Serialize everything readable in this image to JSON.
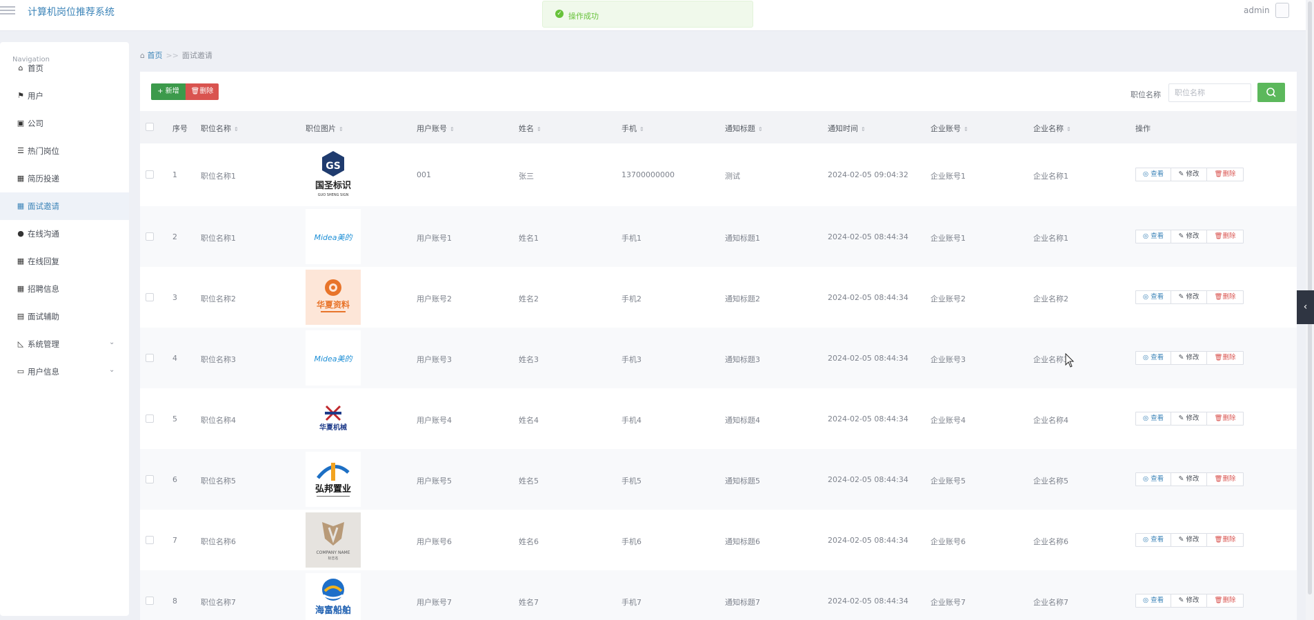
{
  "app": {
    "title": "计算机岗位推荐系统",
    "user": "admin"
  },
  "toast": {
    "message": "操作成功"
  },
  "sidebar": {
    "caption": "Navigation",
    "items": [
      {
        "label": "首页",
        "icon": "home-icon"
      },
      {
        "label": "用户",
        "icon": "flag-icon"
      },
      {
        "label": "公司",
        "icon": "briefcase-icon"
      },
      {
        "label": "热门岗位",
        "icon": "list-icon"
      },
      {
        "label": "简历投递",
        "icon": "grid-icon"
      },
      {
        "label": "面试邀请",
        "icon": "grid-icon",
        "active": true
      },
      {
        "label": "在线沟通",
        "icon": "map-pin-icon"
      },
      {
        "label": "在线回复",
        "icon": "grid-icon"
      },
      {
        "label": "招聘信息",
        "icon": "grid-icon"
      },
      {
        "label": "面试辅助",
        "icon": "comment-icon"
      },
      {
        "label": "系统管理",
        "icon": "chart-icon",
        "expandable": true
      },
      {
        "label": "用户信息",
        "icon": "card-icon",
        "expandable": true
      }
    ]
  },
  "breadcrumb": {
    "home": "首页",
    "separator": ">>",
    "current": "面试邀请"
  },
  "toolbar": {
    "add_label": "新增",
    "delete_label": "删除"
  },
  "search": {
    "label": "职位名称",
    "placeholder": "职位名称"
  },
  "table": {
    "columns": [
      "序号",
      "职位名称",
      "职位图片",
      "用户账号",
      "姓名",
      "手机",
      "通知标题",
      "通知时间",
      "企业账号",
      "企业名称",
      "操作"
    ],
    "actions": {
      "view": "查看",
      "edit": "修改",
      "delete": "删除"
    },
    "rows": [
      {
        "index": "1",
        "job_name": "职位名称1",
        "logo": "guosheng",
        "logo_text": "国圣标识",
        "logo_sub": "GUO SHENG SIGN",
        "account": "001",
        "name": "张三",
        "phone": "13700000000",
        "title": "测试",
        "time": "2024-02-05 09:04:32",
        "company_account": "企业账号1",
        "company_name": "企业名称1"
      },
      {
        "index": "2",
        "job_name": "职位名称1",
        "logo": "midea",
        "logo_text": "Midea美的",
        "logo_sub": "",
        "account": "用户账号1",
        "name": "姓名1",
        "phone": "手机1",
        "title": "通知标题1",
        "time": "2024-02-05 08:44:34",
        "company_account": "企业账号1",
        "company_name": "企业名称1"
      },
      {
        "index": "3",
        "job_name": "职位名称2",
        "logo": "huaxia",
        "logo_text": "华夏资料",
        "logo_sub": "",
        "account": "用户账号2",
        "name": "姓名2",
        "phone": "手机2",
        "title": "通知标题2",
        "time": "2024-02-05 08:44:34",
        "company_account": "企业账号2",
        "company_name": "企业名称2"
      },
      {
        "index": "4",
        "job_name": "职位名称3",
        "logo": "midea",
        "logo_text": "Midea美的",
        "logo_sub": "",
        "account": "用户账号3",
        "name": "姓名3",
        "phone": "手机3",
        "title": "通知标题3",
        "time": "2024-02-05 08:44:34",
        "company_account": "企业账号3",
        "company_name": "企业名称3"
      },
      {
        "index": "5",
        "job_name": "职位名称4",
        "logo": "huaxia-machine",
        "logo_text": "华夏机械",
        "logo_sub": "",
        "account": "用户账号4",
        "name": "姓名4",
        "phone": "手机4",
        "title": "通知标题4",
        "time": "2024-02-05 08:44:34",
        "company_account": "企业账号4",
        "company_name": "企业名称4"
      },
      {
        "index": "6",
        "job_name": "职位名称5",
        "logo": "hongbang",
        "logo_text": "弘邦置业",
        "logo_sub": "",
        "account": "用户账号5",
        "name": "姓名5",
        "phone": "手机5",
        "title": "通知标题5",
        "time": "2024-02-05 08:44:34",
        "company_account": "企业账号5",
        "company_name": "企业名称5"
      },
      {
        "index": "7",
        "job_name": "职位名称6",
        "logo": "company-name",
        "logo_text": "COMPANY NAME",
        "logo_sub": "标志名",
        "account": "用户账号6",
        "name": "姓名6",
        "phone": "手机6",
        "title": "通知标题6",
        "time": "2024-02-05 08:44:34",
        "company_account": "企业账号6",
        "company_name": "企业名称6"
      },
      {
        "index": "8",
        "job_name": "职位名称7",
        "logo": "haiyu",
        "logo_text": "海富船舶",
        "logo_sub": "",
        "account": "用户账号7",
        "name": "姓名7",
        "phone": "手机7",
        "title": "通知标题7",
        "time": "2024-02-05 08:44:34",
        "company_account": "企业账号7",
        "company_name": "企业名称7"
      }
    ]
  }
}
